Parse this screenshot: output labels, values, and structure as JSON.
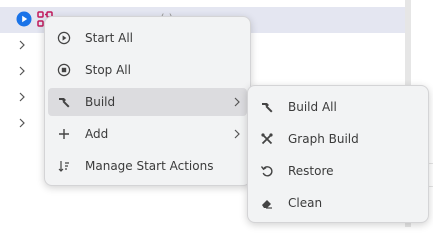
{
  "tree": {
    "rows": [
      {
        "id": "row-0",
        "selected": true,
        "partial_text": "( )"
      },
      {
        "id": "row-1"
      },
      {
        "id": "row-2"
      },
      {
        "id": "row-3"
      },
      {
        "id": "row-4"
      }
    ],
    "icons": {
      "run": "play-circle-icon",
      "app": "app-group-icon",
      "expand": "chevron-right-icon"
    }
  },
  "context_menu": {
    "items": [
      {
        "label": "Start All",
        "icon": "play-circle-icon"
      },
      {
        "label": "Stop All",
        "icon": "stop-circle-icon"
      },
      {
        "label": "Build",
        "icon": "hammer-icon",
        "has_submenu": true,
        "active": true
      },
      {
        "label": "Add",
        "icon": "plus-icon",
        "has_submenu": true
      },
      {
        "label": "Manage Start Actions",
        "icon": "sort-icon"
      }
    ]
  },
  "build_submenu": {
    "items": [
      {
        "label": "Build All",
        "icon": "hammer-icon"
      },
      {
        "label": "Graph Build",
        "icon": "tools-icon"
      },
      {
        "label": "Restore",
        "icon": "restore-icon"
      },
      {
        "label": "Clean",
        "icon": "eraser-icon"
      }
    ]
  },
  "colors": {
    "accent": "#1a73e8",
    "app_icon": "#c2185b",
    "menu_bg": "#f2f3f4",
    "selected_row": "#e4e6f1"
  }
}
